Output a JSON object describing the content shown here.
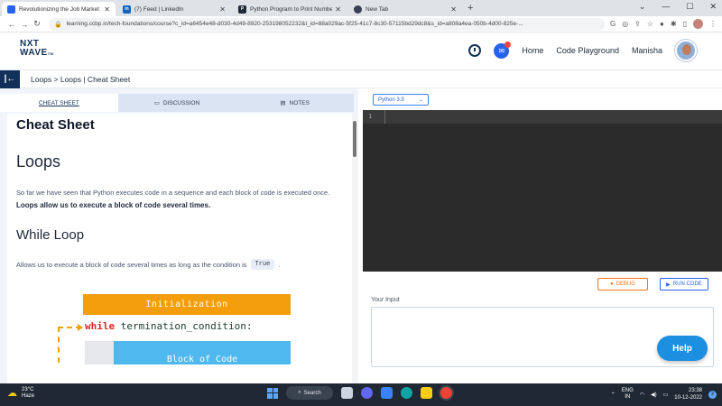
{
  "browser": {
    "tabs": [
      {
        "title": "Revolutionizing the Job Market |",
        "favicon_color": "#2563eb",
        "active": true
      },
      {
        "title": "(7) Feed | LinkedIn",
        "favicon_color": "#0a66c2",
        "active": false
      },
      {
        "title": "Python Program to Print Numbe",
        "favicon_color": "#1f2937",
        "active": false
      },
      {
        "title": "New Tab",
        "favicon_color": "#374151",
        "active": false
      }
    ],
    "url": "learning.ccbp.in/tech-foundations/course?c_id=a6454e48-d030-4d49-8920-253198052232&t_id=88a029ac-5f25-41c7-8c30-57115bd29dc8&s_id=a808a4ea-050b-4d00-825e-..."
  },
  "header": {
    "logo_line1": "NXT",
    "logo_line2": "WAVE",
    "logo_tm": "TM",
    "nav": [
      "Home",
      "Code Playground"
    ],
    "user_name": "Manisha"
  },
  "breadcrumb": "Loops > Loops | Cheat Sheet",
  "content_tabs": [
    {
      "label": "CHEAT SHEET",
      "icon": "none",
      "active": true
    },
    {
      "label": "DISCUSSION",
      "icon": "chat-icon",
      "active": false
    },
    {
      "label": "NOTES",
      "icon": "notes-icon",
      "active": false
    }
  ],
  "cheatsheet": {
    "title": "Cheat Sheet",
    "section1_heading": "Loops",
    "section1_text": "So far we have seen that Python executes code in a sequence and each block of code is executed once.",
    "section1_bold": "Loops allow us to execute a block of code several times.",
    "section2_heading": "While Loop",
    "section2_text_before": "Allows us to execute a block of code several times as long as the condition is",
    "section2_code": "True",
    "section2_text_after": "."
  },
  "diagram": {
    "init_label": "Initialization",
    "while_keyword": "while",
    "while_rest": " termination_condition:",
    "block_label": "Block of Code"
  },
  "editor": {
    "language": "Python 3.9",
    "line_number": "1",
    "debug_label": "DEBUG",
    "run_label": "RUN CODE",
    "input_label": "Your Input",
    "help_label": "Help"
  },
  "taskbar": {
    "temperature": "23°C",
    "weather": "Haze",
    "search_label": "Search",
    "lang_line1": "ENG",
    "lang_line2": "IN",
    "time": "23:38",
    "date": "10-12-2022",
    "notifications": "2"
  },
  "colors": {
    "brand": "#12315a",
    "accent_blue": "#2563eb",
    "debug_orange": "#f97316",
    "init_orange": "#f59e0b",
    "block_blue": "#4fb8ee"
  }
}
